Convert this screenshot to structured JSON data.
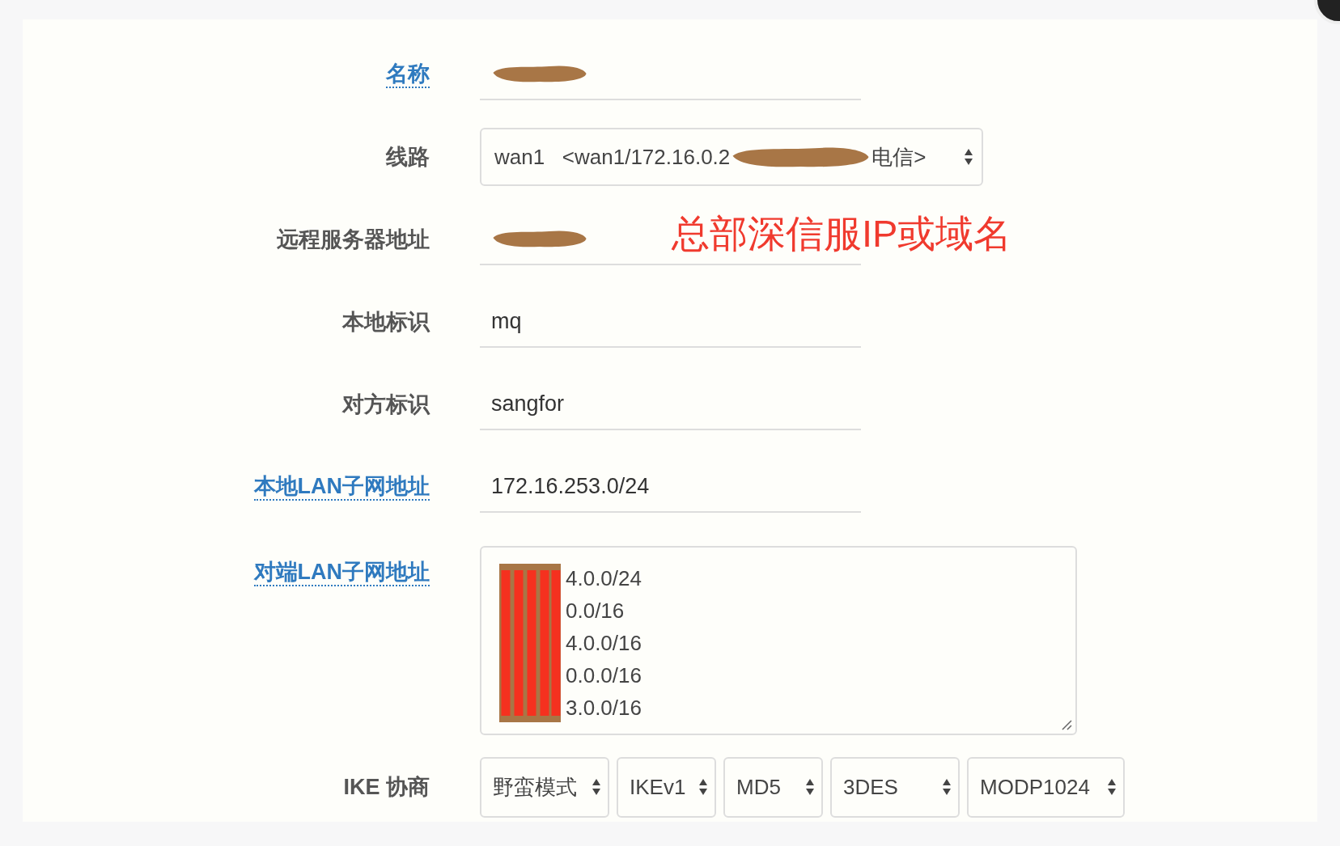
{
  "fields": [
    {
      "kind": "text",
      "label": "名称",
      "linked": true,
      "redacted": true
    },
    {
      "kind": "select",
      "label": "线路",
      "linked": false,
      "value_before": "wan1   <wan1/172.16.0.2",
      "redacted": true,
      "value_after": "电信>"
    },
    {
      "kind": "text",
      "label": "远程服务器地址",
      "linked": false,
      "redacted": true,
      "annotation": "总部深信服IP或域名"
    },
    {
      "kind": "text",
      "label": "本地标识",
      "linked": false,
      "value": "mq"
    },
    {
      "kind": "text",
      "label": "对方标识",
      "linked": false,
      "value": "sangfor"
    },
    {
      "kind": "text",
      "label": "本地LAN子网地址",
      "linked": true,
      "value": "172.16.253.0/24"
    },
    {
      "kind": "textarea",
      "label": "对端LAN子网地址",
      "linked": true,
      "redacted": true,
      "lines": [
        "4.0.0/24",
        "0.0/16",
        "4.0.0/16",
        "0.0.0/16",
        "3.0.0/16"
      ]
    },
    {
      "kind": "selects",
      "label": "IKE 协商",
      "linked": false,
      "options": [
        "野蛮模式",
        "IKEv1",
        "MD5",
        "3DES",
        "MODP1024"
      ]
    }
  ]
}
